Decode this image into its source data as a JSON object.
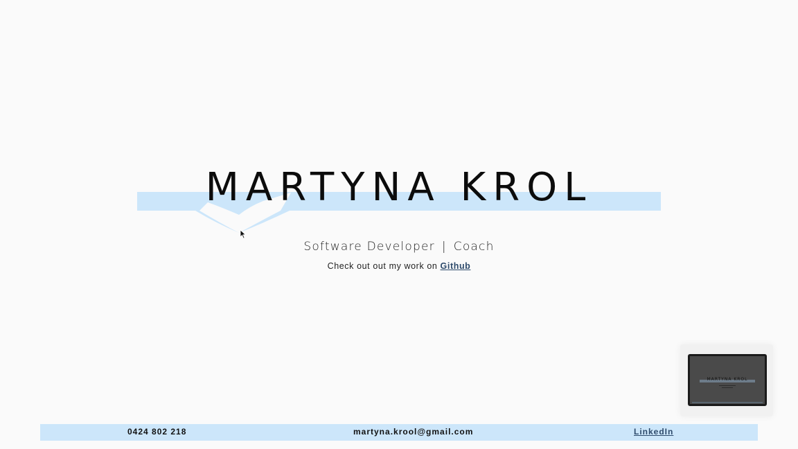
{
  "hero": {
    "name": "MARTYNA KROL",
    "subtitle_left": "Software Developer",
    "subtitle_sep": "|",
    "subtitle_right": "Coach",
    "github_prefix": "Check out out my work on ",
    "github_link": "Github"
  },
  "footer": {
    "phone": "0424 802 218",
    "email": "martyna.krool@gmail.com",
    "linkedin": "LinkedIn"
  },
  "thumbnail": {
    "title": "MARTYNA KROL"
  },
  "colors": {
    "accent_band": "#cce6fa",
    "link": "#2d4a6b",
    "background": "#fafafa"
  },
  "icons": {
    "cursor": "arrow-cursor-icon"
  }
}
